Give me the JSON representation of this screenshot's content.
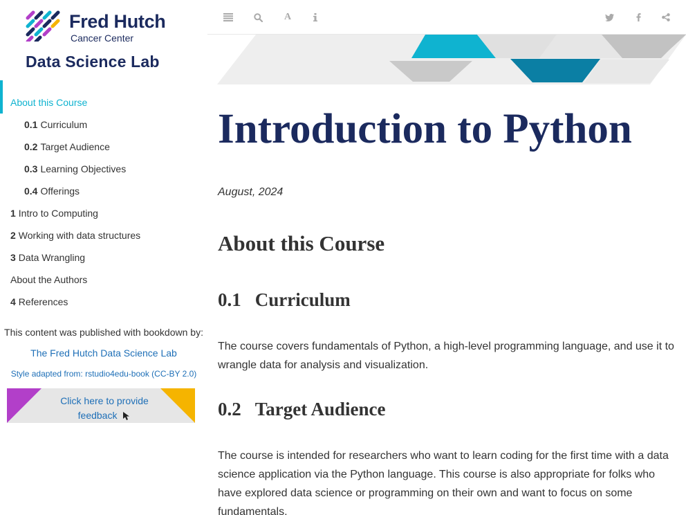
{
  "logo": {
    "title": "Fred Hutch",
    "subtitle": "Cancer Center",
    "lab": "Data Science Lab"
  },
  "toolbar": {
    "buttons": [
      "sidebar-toggle-icon",
      "search-icon",
      "font-settings-icon",
      "info-icon",
      "twitter-icon",
      "facebook-icon",
      "share-icon"
    ],
    "font_button_label": "A"
  },
  "sidebar": {
    "items": [
      {
        "num": "",
        "label": "About this Course",
        "active": true
      },
      {
        "num": "0.1",
        "label": "Curriculum"
      },
      {
        "num": "0.2",
        "label": "Target Audience"
      },
      {
        "num": "0.3",
        "label": "Learning Objectives"
      },
      {
        "num": "0.4",
        "label": "Offerings"
      },
      {
        "num": "1",
        "label": "Intro to Computing"
      },
      {
        "num": "2",
        "label": "Working with data structures"
      },
      {
        "num": "3",
        "label": "Data Wrangling"
      },
      {
        "num": "",
        "label": "About the Authors"
      },
      {
        "num": "4",
        "label": "References"
      }
    ],
    "published_with": "This content was published with bookdown by:",
    "publisher_link": "The Fred Hutch Data Science Lab",
    "style_credit": "Style adapted from: rstudio4edu-book (CC-BY 2.0)",
    "feedback_label": "Click here to provide feedback"
  },
  "colors": {
    "accent": "#0fb3d0",
    "navy": "#1b2a5e",
    "link": "#1e6fb7",
    "feedback_purple": "#b23fc9",
    "feedback_yellow": "#f5b400"
  },
  "main": {
    "title": "Introduction to Python",
    "date": "August, 2024",
    "section_heading": "About this Course",
    "subsections": [
      {
        "num": "0.1",
        "heading": "Curriculum",
        "body": "The course covers fundamentals of Python, a high-level programming language, and use it to wrangle data for analysis and visualization."
      },
      {
        "num": "0.2",
        "heading": "Target Audience",
        "body": "The course is intended for researchers who want to learn coding for the first time with a data science application via the Python language. This course is also appropriate for folks who have explored data science or programming on their own and want to focus on some fundamentals."
      }
    ]
  }
}
